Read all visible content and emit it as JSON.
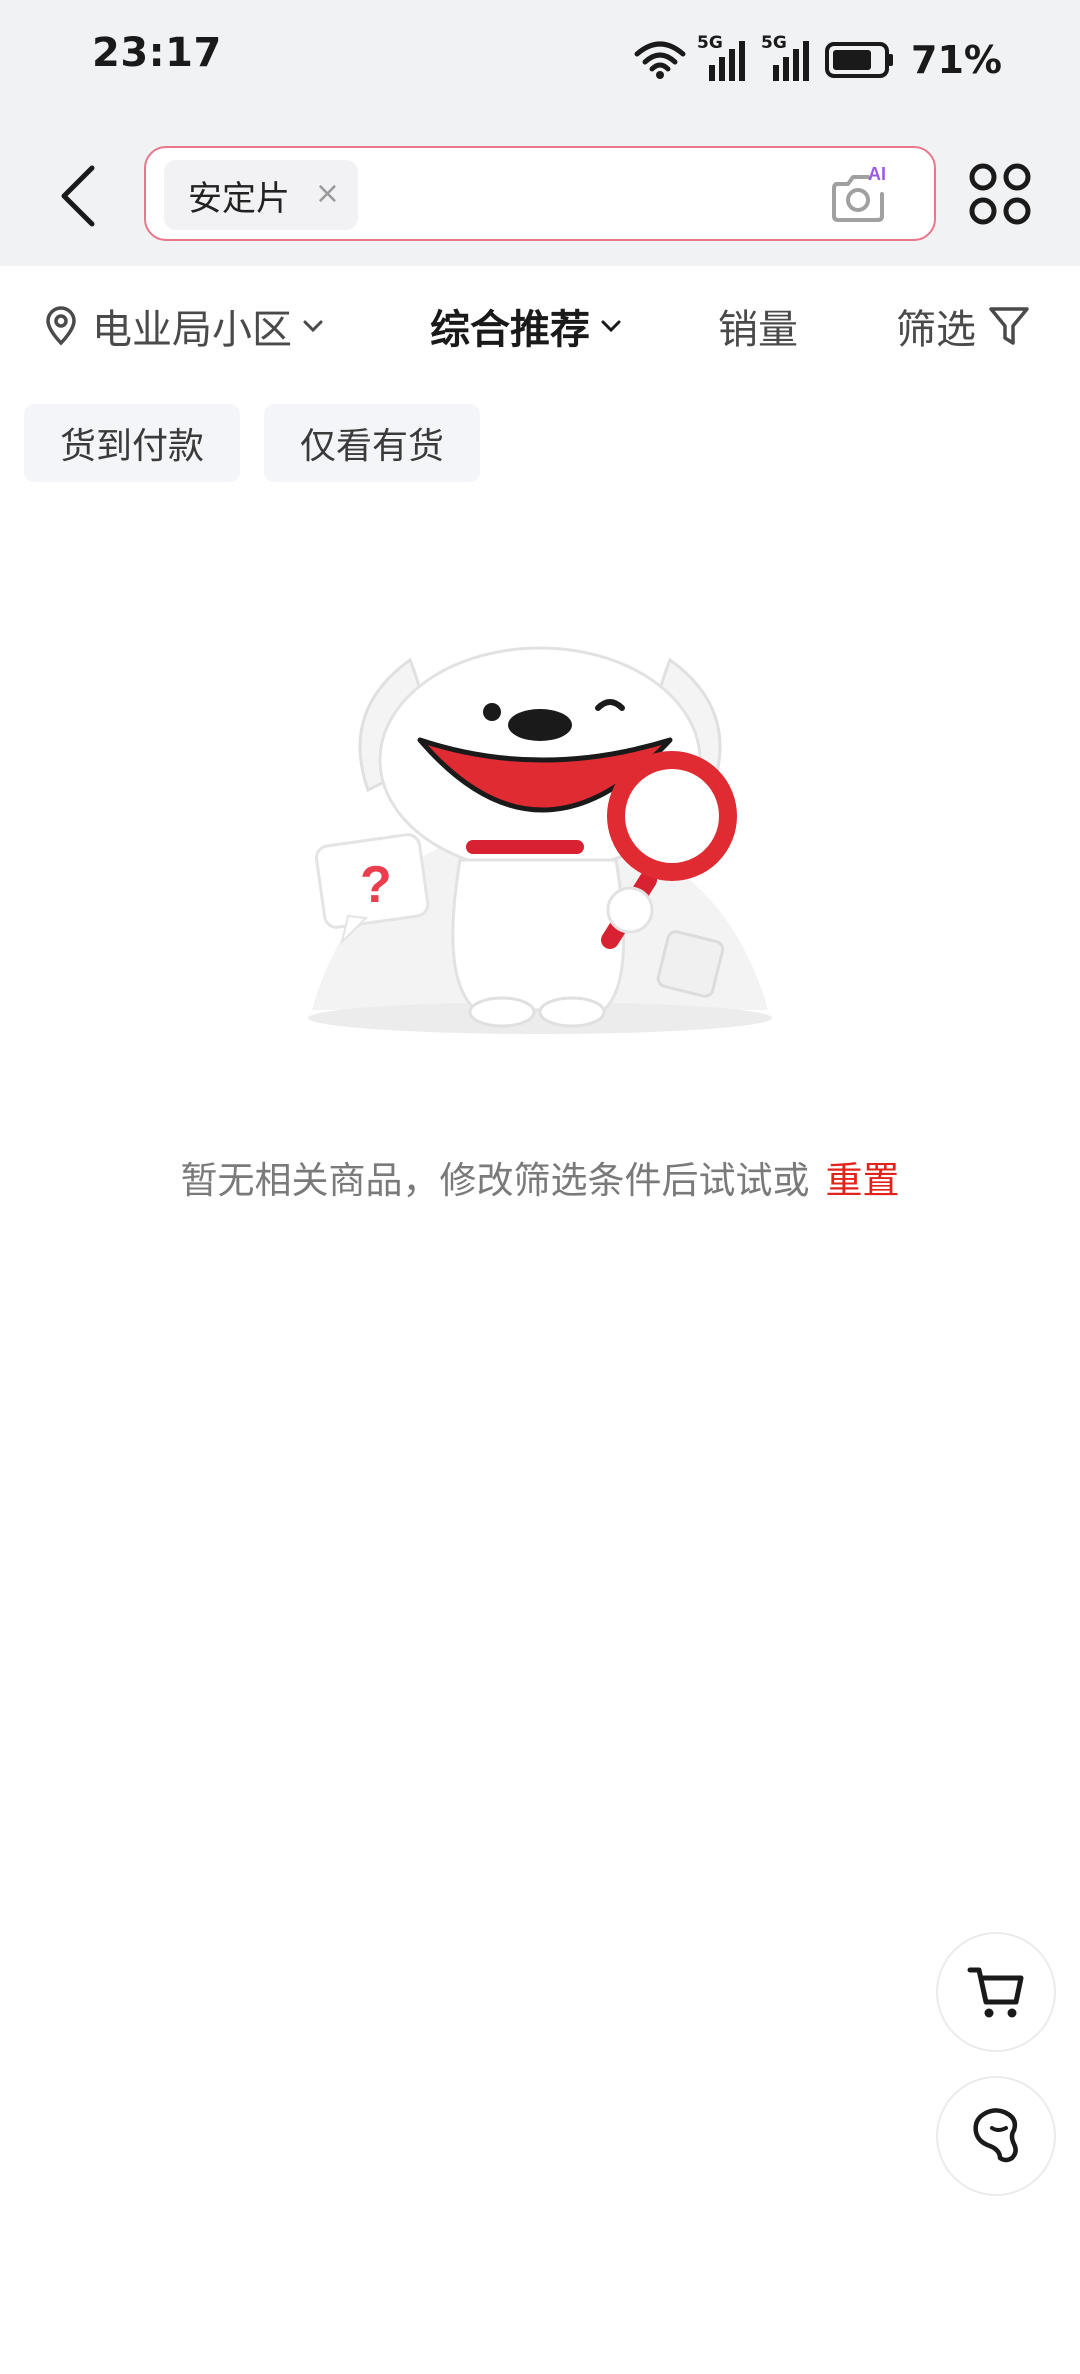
{
  "status_bar": {
    "time": "23:17",
    "network_1": "5G",
    "network_2": "5G",
    "battery": "71%"
  },
  "header": {
    "search_keyword": "安定片",
    "clear_symbol": "×",
    "camera_badge": "AI",
    "icons": [
      "back-arrow-icon",
      "camera-ai-icon",
      "apps-grid-icon"
    ]
  },
  "sort_bar": {
    "location": "电业局小区",
    "recommend": "综合推荐",
    "sales": "销量",
    "filter": "筛选"
  },
  "quick_filters": {
    "cash_on_delivery": "货到付款",
    "in_stock_only": "仅看有货"
  },
  "empty_state": {
    "message": "暂无相关商品，修改筛选条件后试试或",
    "reset_link": "重置",
    "illustration_mark": "?"
  },
  "floating": {
    "icons": [
      "cart-icon",
      "footprint-icon"
    ]
  },
  "colors": {
    "accent": "#e2231a",
    "search_border": "#e9778a",
    "header_bg": "#f1f2f4"
  }
}
